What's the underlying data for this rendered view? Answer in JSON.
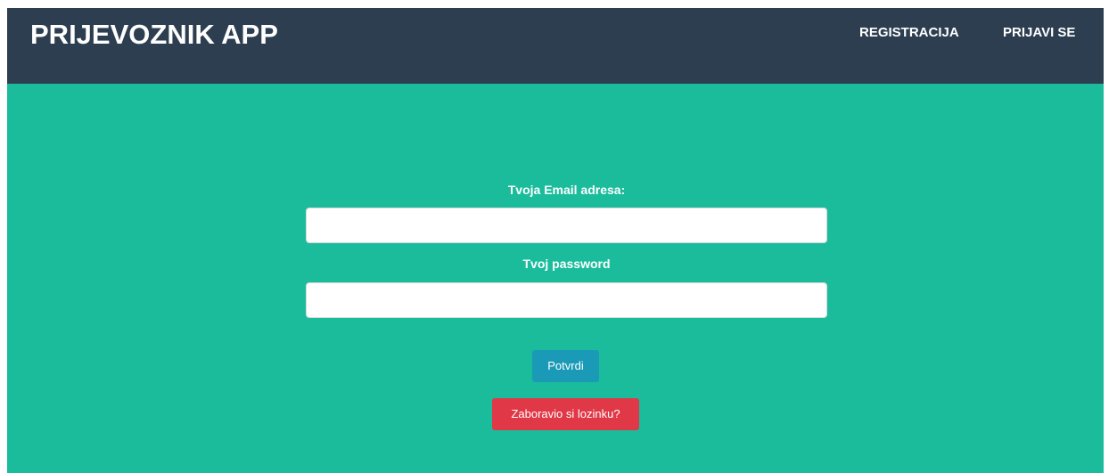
{
  "navbar": {
    "brand": "PRIJEVOZNIK APP",
    "links": [
      {
        "label": "REGISTRACIJA"
      },
      {
        "label": "PRIJAVI SE"
      }
    ]
  },
  "login_form": {
    "email_label": "Tvoja Email adresa:",
    "email_value": "",
    "password_label": "Tvoj password",
    "password_value": "",
    "submit_label": "Potvrdi",
    "forgot_label": "Zaboravio si lozinku?"
  },
  "colors": {
    "navbar_bg": "#2c3e50",
    "hero_bg": "#1abc9c",
    "submit_bg": "#1a9ab7",
    "forgot_bg": "#e03846"
  }
}
